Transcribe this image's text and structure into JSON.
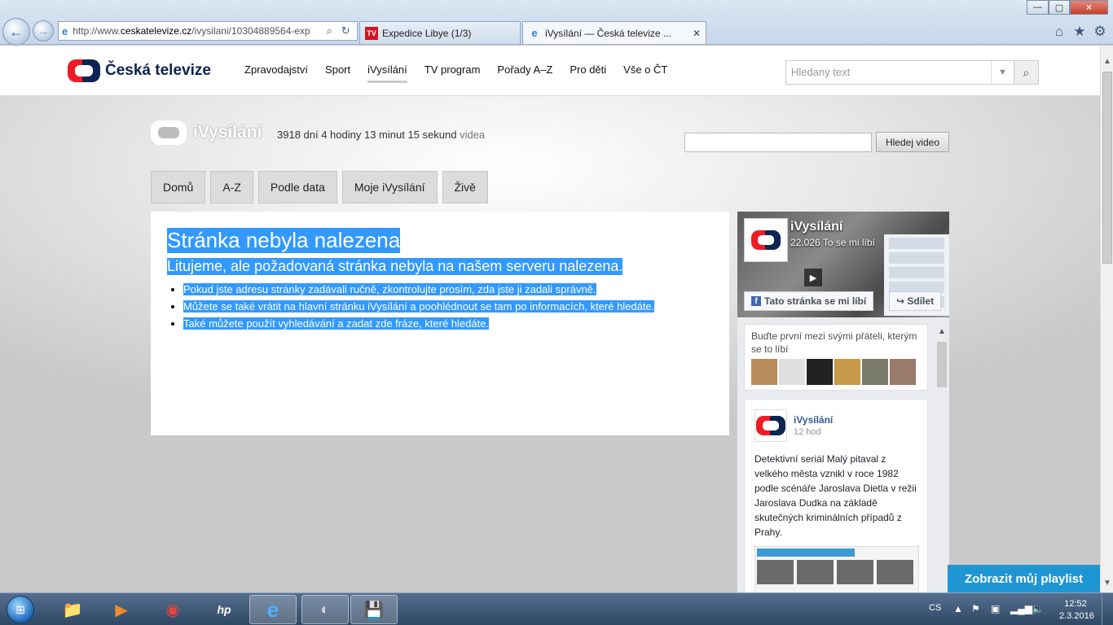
{
  "browser": {
    "url_prefix": "http://www.",
    "url_domain": "ceskatelevize.cz",
    "url_rest": "/ivysilani/10304889564-exp",
    "tabs": [
      {
        "label": "Expedice Libye (1/3)",
        "favicon": "TV"
      },
      {
        "label": "iVysílání — Česká televize ...",
        "favicon": "e"
      }
    ],
    "window_buttons": {
      "minimize": "—",
      "maximize": "▢",
      "close": "✕"
    },
    "icons": {
      "home": "⌂",
      "favorites": "★",
      "tools": "⚙",
      "back": "←",
      "forward": "→",
      "search": "⌕",
      "refresh": "↻",
      "close_tab": "✕"
    }
  },
  "site": {
    "logo_text": "Česká televize",
    "nav": [
      "Zpravodajství",
      "Sport",
      "iVysílání",
      "TV program",
      "Pořady A–Z",
      "Pro děti",
      "Vše o ČT"
    ],
    "active_nav": "iVysílání",
    "search_placeholder": "Hledaný text"
  },
  "ivysilani": {
    "logo_text": "iVysílání",
    "counter": "3918 dní 4 hodiny 13 minut 15 sekund",
    "counter_suffix": "videa",
    "search_button": "Hledej video",
    "tabs": [
      "Domů",
      "A-Z",
      "Podle data",
      "Moje iVysílání",
      "Živě"
    ]
  },
  "error": {
    "title": "Stránka nebyla nalezena",
    "subtitle": "Litujeme, ale požadovaná stránka nebyla na našem serveru nalezena.",
    "items": [
      "Pokud jste adresu stránky zadávali ručně, zkontrolujte prosím, zda jste ji zadali správně.",
      "Můžete se také vrátit na hlavní stránku iVysílání a poohlédnout se tam po informacích, které hledáte.",
      "Také můžete použít vyhledávání a zadat zde fráze, které hledáte."
    ]
  },
  "facebook": {
    "page_name": "iVysílání",
    "likes": "22.026 To se mi líbí",
    "like_button": "Tato stránka se mi líbí",
    "share_button": "Sdílet",
    "friends_text": "Buďte první mezi svými přáteli, kterým se to líbí",
    "face_colors": [
      "#b98a5a",
      "#e0e0e0",
      "#222222",
      "#c79a4a",
      "#7a7a6a",
      "#9a7a6a"
    ],
    "post": {
      "author": "iVysílání",
      "time": "12 hod",
      "text": "Detektivní seriál Malý pitaval z velkého města vznikl v roce 1982 podle scénáře Jaroslava Dietla v režii Jaroslava Dudka na základě skutečných kriminálních případů z Prahy."
    }
  },
  "playlist_button": "Zobrazit můj playlist",
  "taskbar": {
    "apps": [
      {
        "name": "explorer",
        "icon": "📁"
      },
      {
        "name": "media-player",
        "icon": "▶"
      },
      {
        "name": "chrome",
        "icon": "◉"
      },
      {
        "name": "hp",
        "icon": "hp"
      },
      {
        "name": "internet-explorer",
        "icon": "e"
      },
      {
        "name": "app",
        "icon": "◐"
      },
      {
        "name": "save",
        "icon": "💾"
      }
    ],
    "language": "CS",
    "time": "12:52",
    "date": "2.3.2016"
  },
  "colors": {
    "ct_red": "#ed1c24",
    "ct_navy": "#0c2451",
    "selection": "#3399ff",
    "playlist_blue": "#1e96d3",
    "fb_blue": "#4267b2"
  }
}
